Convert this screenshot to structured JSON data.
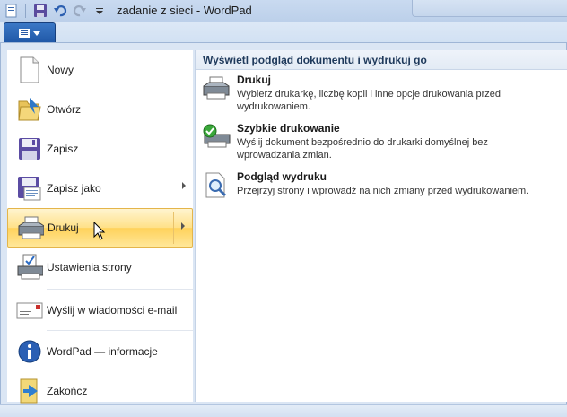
{
  "window": {
    "title": "zadanie z sieci - WordPad"
  },
  "qat_icons": [
    "wordpad-icon",
    "save-icon",
    "undo-icon",
    "redo-icon",
    "customize-qat-icon"
  ],
  "menu": {
    "items": [
      {
        "label": "Nowy",
        "icon": "new-document-icon"
      },
      {
        "label": "Otwórz",
        "icon": "open-folder-icon"
      },
      {
        "label": "Zapisz",
        "icon": "save-icon"
      },
      {
        "label": "Zapisz jako",
        "icon": "save-as-icon"
      },
      {
        "label": "Drukuj",
        "icon": "printer-icon"
      },
      {
        "label": "Ustawienia strony",
        "icon": "page-setup-icon"
      },
      {
        "label": "Wyślij w wiadomości e-mail",
        "icon": "email-icon"
      },
      {
        "label": "WordPad — informacje",
        "icon": "info-icon"
      },
      {
        "label": "Zakończ",
        "icon": "exit-icon"
      }
    ]
  },
  "submenu": {
    "header": "Wyświetl podgląd dokumentu i wydrukuj go",
    "items": [
      {
        "title": "Drukuj",
        "desc": "Wybierz drukarkę, liczbę kopii i inne opcje drukowania przed wydrukowaniem."
      },
      {
        "title": "Szybkie drukowanie",
        "desc": "Wyślij dokument bezpośrednio do drukarki domyślnej bez wprowadzania zmian."
      },
      {
        "title": "Podgląd wydruku",
        "desc": "Przejrzyj strony i wprowadź na nich zmiany przed wydrukowaniem."
      }
    ]
  },
  "colors": {
    "accent": "#1f57a6",
    "highlight": "#ffd25a"
  }
}
